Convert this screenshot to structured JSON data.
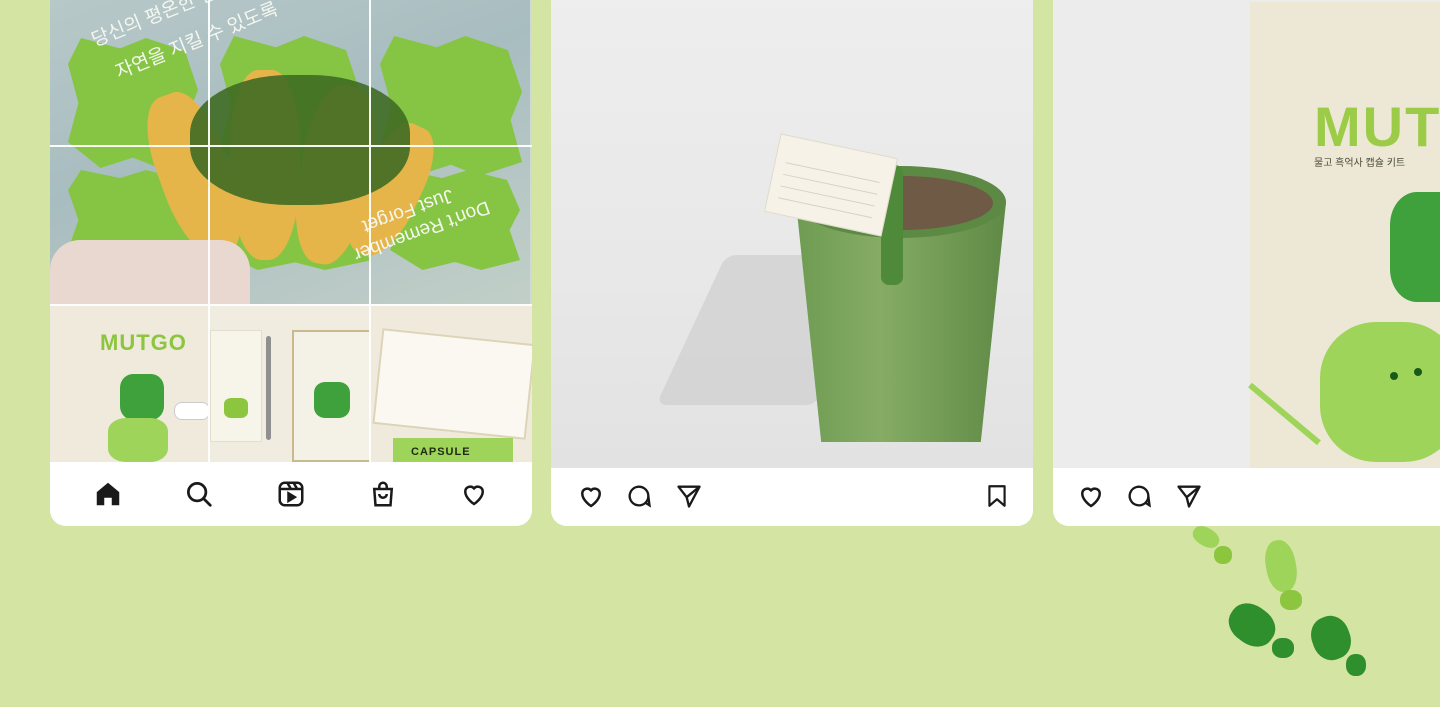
{
  "post1": {
    "kr_line1": "당신의 평온한 일상과",
    "kr_line2": "자연을 지킬 수 있도록",
    "en_line1": "Don't Remember",
    "en_line2": "Just Forget",
    "mini_logo": "MUTGO",
    "capsule_label": "CAPSULE"
  },
  "nav": {
    "icons": [
      "home-icon",
      "search-icon",
      "reels-icon",
      "shop-icon",
      "heart-icon"
    ]
  },
  "post2": {
    "actions": [
      "heart-icon",
      "comment-icon",
      "send-icon",
      "bookmark-icon"
    ]
  },
  "post3": {
    "book_logo": "MUT",
    "book_subtitle": "물고 흑억사 캡슐 키트",
    "actions": [
      "heart-icon",
      "comment-icon",
      "send-icon"
    ]
  },
  "colors": {
    "background": "#d3e4a3",
    "accent_green": "#86c543",
    "dark_green": "#3fa13b",
    "icon": "#1a1a1a"
  }
}
